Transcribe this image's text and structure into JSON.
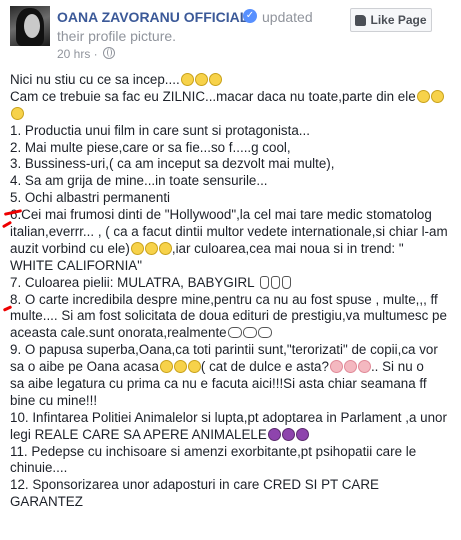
{
  "header": {
    "page_name": "OANA ZAVORANU OFFICIAL",
    "action": "updated",
    "subtitle": "their profile picture.",
    "timestamp": "20 hrs · ",
    "like_button_label": "Like Page"
  },
  "icons": {
    "verified": "verified-badge-icon",
    "privacy": "globe-icon",
    "like": "thumbs-up-icon",
    "emoji_smile": "slightly-smiling-face",
    "emoji_grin": "grinning-face",
    "emoji_heart": "heart",
    "emoji_hand": "raised-hand",
    "emoji_clap": "clapping-hands",
    "emoji_devil": "smiling-devil"
  },
  "colors": {
    "page_name": "#3b5998",
    "meta_text": "#90949c",
    "body_text": "#1d2129",
    "annotation_marks": "#e00000"
  },
  "post": {
    "lines": [
      "Nici nu stiu cu ce sa incep....",
      "Cam ce trebuie sa fac eu ZILNIC...macar daca nu toate,parte din ele",
      "",
      "1. Productia unui film in care sunt si protagonista...",
      "2. Mai multe piese,care or sa fie...so f.....g cool,",
      "3. Bussiness-uri,( ca am inceput sa dezvolt mai multe),",
      "4. Sa am grija de mine...in toate sensurile...",
      "5. Ochi albastri permanenti",
      "6.Cei mai frumosi dinti de \"Hollywood\",la cel mai tare medic stomatolog",
      "italian,everrr... , ( ca a facut dintii multor vedete internationale,si chiar l-am",
      "auzit vorbind cu ele)",
      ",iar culoarea,cea mai noua si in trend: \"",
      "WHITE CALIFORNIA\"",
      "7. Culoarea pielii: MULATRA, BABYGIRL",
      "8. O carte incredibila despre mine,pentru ca nu au fost spuse , multe,,, ff",
      "multe.... Si am fost solicitata de doua edituri de prestigiu,va multumesc pe",
      "aceasta cale.sunt onorata,realmente",
      "9. O papusa superba,Oana,ca toti parintii sunt,\"terorizati\" de copii,ca vor",
      "sa o aibe pe Oana acasa",
      "( cat de dulce e asta?",
      ".. Si nu o",
      "sa aibe legatura cu prima ca nu e facuta aici!!!Si asta chiar seamana ff",
      "bine cu mine!!!",
      "10. Infintarea Politiei Animalelor si lupta,pt adoptarea in Parlament ,a unor",
      "legi REALE CARE SA APERE ANIMALELE",
      "11. Pedepse cu inchisoare si amenzi exorbitante,pt psihopatii care le",
      "chinuie....",
      "12. Sponsorizarea unor adaposturi in care CRED SI PT CARE",
      "GARANTEZ"
    ]
  }
}
